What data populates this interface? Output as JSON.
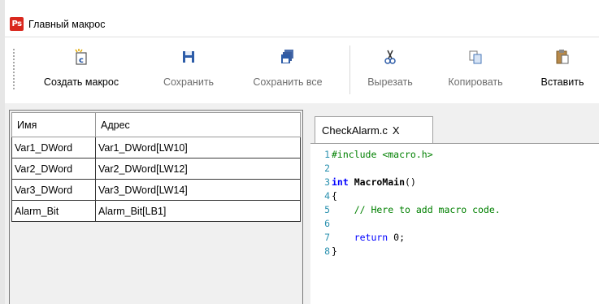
{
  "window": {
    "title": "Главный макрос"
  },
  "toolbar": {
    "create": {
      "label": "Создать макрос",
      "icon": "new-macro-icon"
    },
    "save": {
      "label": "Сохранить",
      "icon": "floppy-disk-icon"
    },
    "save_all": {
      "label": "Сохранить все",
      "icon": "save-all-icon"
    },
    "cut": {
      "label": "Вырезать",
      "icon": "scissors-icon"
    },
    "copy": {
      "label": "Копировать",
      "icon": "copy-icon"
    },
    "paste": {
      "label": "Вставить",
      "icon": "clipboard-icon"
    }
  },
  "variables": {
    "headers": {
      "name": "Имя",
      "address": "Адрес"
    },
    "rows": [
      {
        "name": "Var1_DWord",
        "address": "Var1_DWord[LW10]"
      },
      {
        "name": "Var2_DWord",
        "address": "Var2_DWord[LW12]"
      },
      {
        "name": "Var3_DWord",
        "address": "Var3_DWord[LW14]"
      },
      {
        "name": "Alarm_Bit",
        "address": "Alarm_Bit[LB1]"
      }
    ]
  },
  "editor": {
    "tab_label": "CheckAlarm.c",
    "tab_close": "X",
    "lines": [
      {
        "n": "1",
        "t1": "#include",
        "t2": " <macro.h>"
      },
      {
        "n": "2"
      },
      {
        "n": "3",
        "t1": "int",
        "t2": " MacroMain",
        "t3": "()"
      },
      {
        "n": "4",
        "t1": "{"
      },
      {
        "n": "5",
        "t1": "    // Here to add macro code."
      },
      {
        "n": "6"
      },
      {
        "n": "7",
        "t1": "    return",
        "t2": " 0;"
      },
      {
        "n": "8",
        "t1": "}"
      }
    ]
  },
  "colors": {
    "keyword": "#0000ff",
    "comment": "#008000",
    "line_number": "#2b91af",
    "logo": "#d9281e"
  }
}
